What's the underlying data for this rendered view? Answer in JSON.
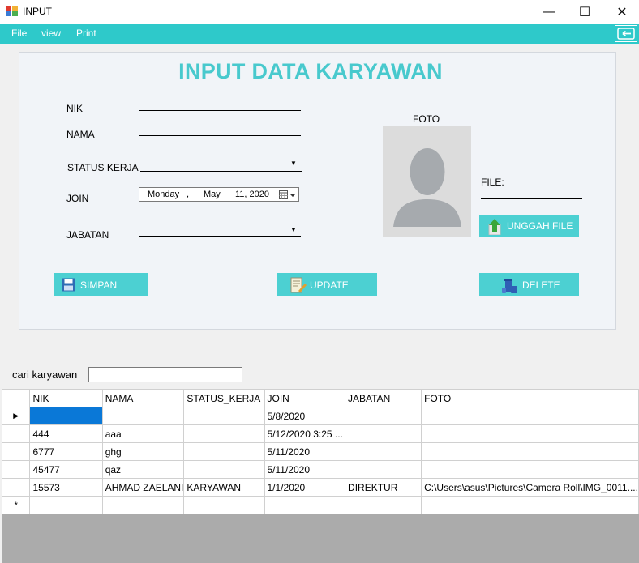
{
  "window": {
    "title": "INPUT",
    "controls": {
      "minimize": "—",
      "maximize": "☐",
      "close": "✕"
    }
  },
  "menu": {
    "items": [
      "File",
      "view",
      "Print"
    ]
  },
  "form": {
    "title": "INPUT DATA KARYAWAN",
    "labels": {
      "nik": "NIK",
      "nama": "NAMA",
      "status": "STATUS KERJA",
      "join": "JOIN",
      "jabatan": "JABATAN",
      "foto": "FOTO",
      "file": "FILE:"
    },
    "join_date": {
      "day": "Monday",
      "sep": ",",
      "month": "May",
      "date": "11, 2020"
    },
    "buttons": {
      "unggah": "UNGGAH FILE",
      "simpan": "SIMPAN",
      "update": "UPDATE",
      "delete": "DELETE"
    }
  },
  "search": {
    "label": "cari karyawan",
    "value": ""
  },
  "grid": {
    "columns": [
      "NIK",
      "NAMA",
      "STATUS_KERJA",
      "JOIN",
      "JABATAN",
      "FOTO"
    ],
    "rows": [
      {
        "marker": "▶",
        "cells": [
          "",
          "",
          "",
          "5/8/2020",
          "",
          ""
        ]
      },
      {
        "marker": "",
        "cells": [
          "444",
          "aaa",
          "",
          "5/12/2020 3:25 ...",
          "",
          ""
        ]
      },
      {
        "marker": "",
        "cells": [
          "6777",
          "ghg",
          "",
          "5/11/2020",
          "",
          ""
        ]
      },
      {
        "marker": "",
        "cells": [
          "45477",
          "qaz",
          "",
          "5/11/2020",
          "",
          ""
        ]
      },
      {
        "marker": "",
        "cells": [
          "15573",
          "AHMAD ZAELANI",
          "KARYAWAN",
          "1/1/2020",
          "DIREKTUR",
          "C:\\Users\\asus\\Pictures\\Camera Roll\\IMG_0011...."
        ]
      },
      {
        "marker": "*",
        "cells": [
          "",
          "",
          "",
          "",
          "",
          ""
        ]
      }
    ]
  },
  "colors": {
    "accent": "#2ec9ca",
    "title": "#48c9cd",
    "button": "#4cd0d2",
    "selection": "#0a78d7"
  }
}
